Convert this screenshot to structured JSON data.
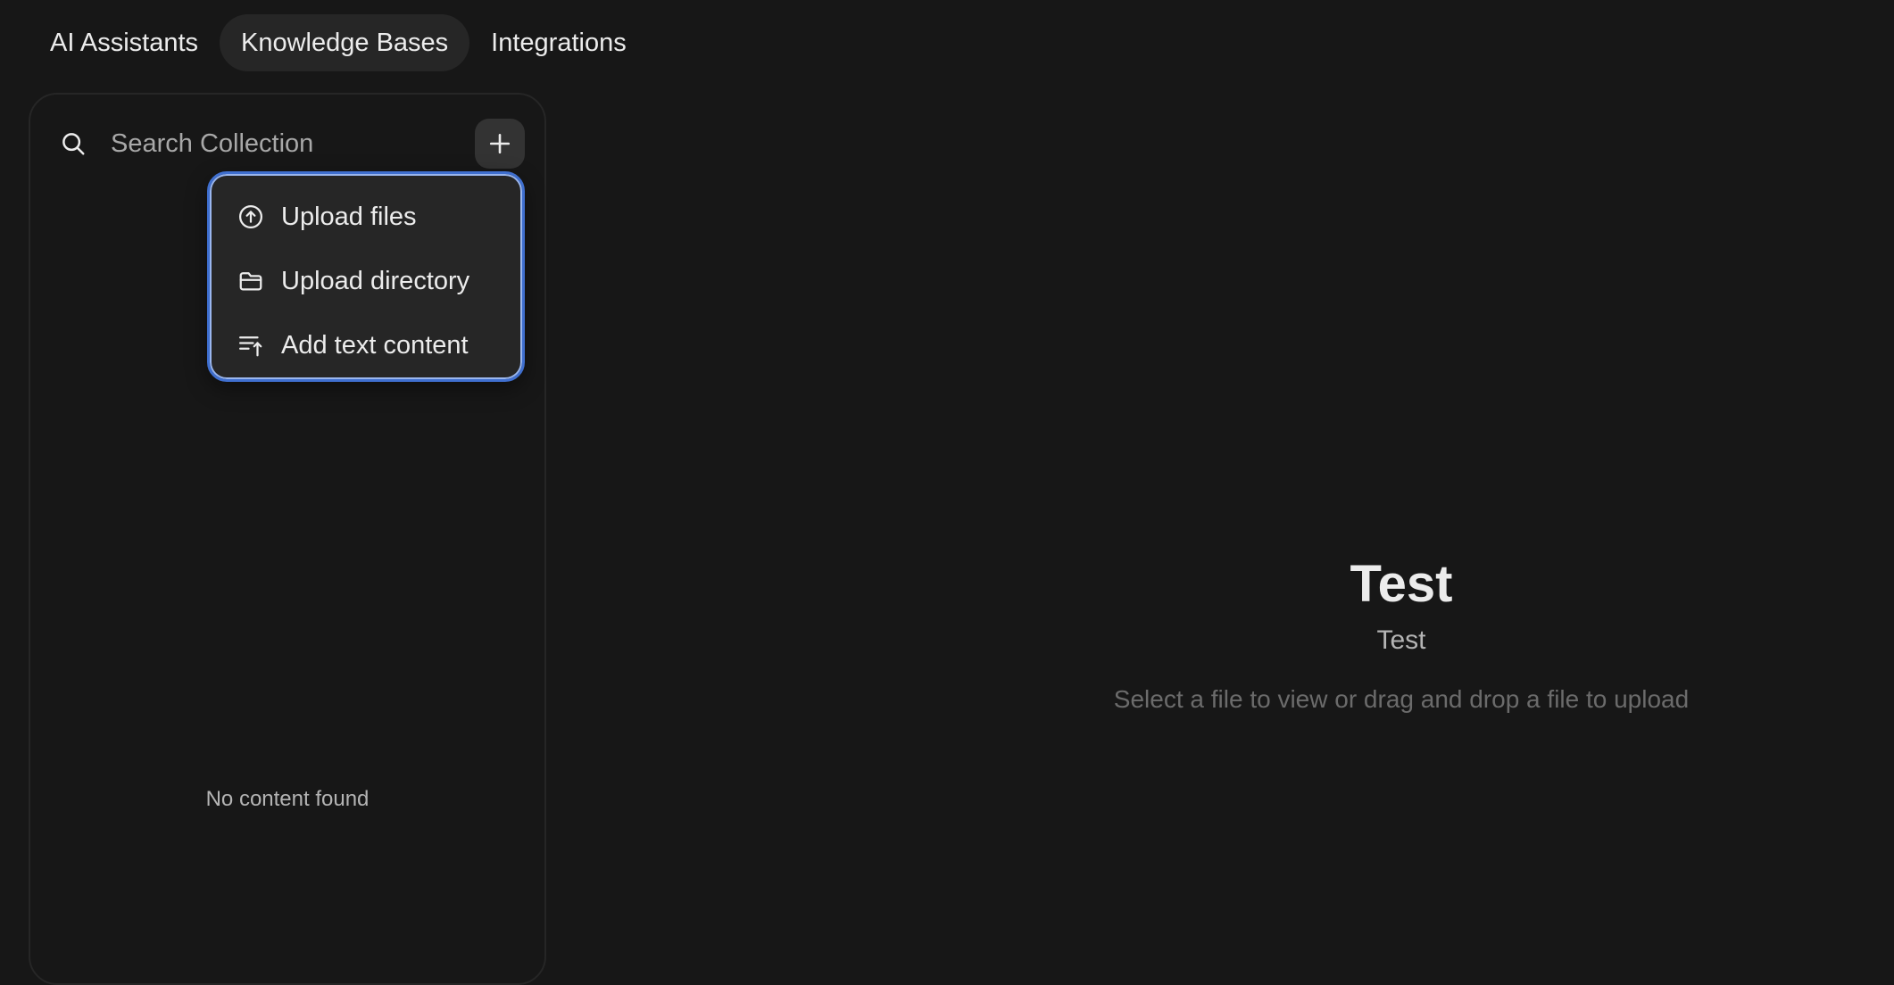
{
  "tabs": [
    {
      "label": "AI Assistants",
      "active": false
    },
    {
      "label": "Knowledge Bases",
      "active": true
    },
    {
      "label": "Integrations",
      "active": false
    }
  ],
  "sidebar": {
    "search": {
      "placeholder": "Search Collection",
      "value": "",
      "icon": "search-icon"
    },
    "add_button_icon": "plus-icon",
    "empty_text": "No content found"
  },
  "menu": {
    "items": [
      {
        "label": "Upload files",
        "icon": "upload-circle-icon"
      },
      {
        "label": "Upload directory",
        "icon": "folder-open-icon"
      },
      {
        "label": "Add text content",
        "icon": "text-upload-icon"
      }
    ],
    "focus_color": "#3f6fcf"
  },
  "main": {
    "title": "Test",
    "subtitle": "Test",
    "hint": "Select a file to view or drag and drop a file to upload"
  },
  "colors": {
    "background": "#171717",
    "surface": "#262626",
    "text": "#ececec",
    "muted": "#b4b4b4",
    "faint": "#6b6b6b"
  }
}
